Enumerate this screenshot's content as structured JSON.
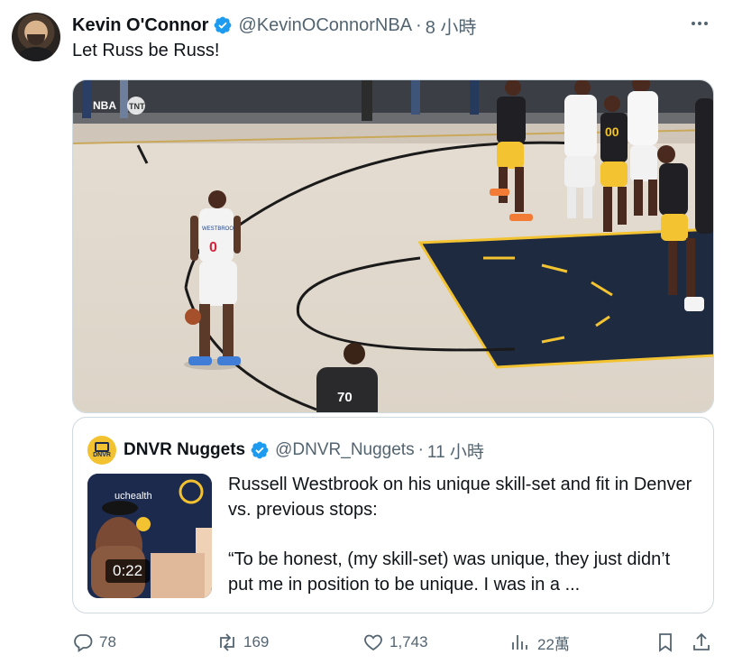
{
  "tweet": {
    "author_name": "Kevin O'Connor",
    "handle": "@KevinOConnorNBA",
    "separator": "·",
    "time": "8 小時",
    "text": "Let Russ be Russ!",
    "more_icon": "more-icon"
  },
  "media": {
    "jersey_number": "0",
    "jersey_name": "WESTBROOK",
    "referee_number": "70",
    "opponent_number": "00",
    "watermark_nba": "NBA",
    "watermark_tnt": "TNT"
  },
  "quote": {
    "author_name": "DNVR Nuggets",
    "logo_text": "DNVR",
    "handle": "@DNVR_Nuggets",
    "separator": "·",
    "time": "11 小時",
    "video_duration": "0:22",
    "thumb_banner": "uchealth",
    "paragraph1": "Russell Westbrook on his unique skill-set and fit in Denver vs. previous stops:",
    "paragraph2": "“To be honest, (my skill-set) was unique, they just didn’t put me in position to be unique. I was in a ..."
  },
  "actions": {
    "replies": "78",
    "reposts": "169",
    "likes": "1,743",
    "views": "22萬"
  },
  "colors": {
    "verified": "#1d9bf0",
    "secondary_text": "#536471",
    "primary_text": "#0f1419",
    "border": "#cfd9de"
  }
}
